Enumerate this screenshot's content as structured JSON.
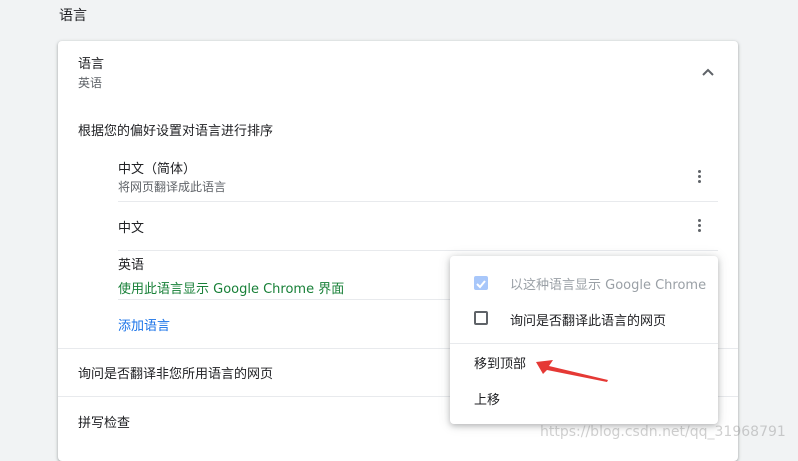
{
  "section_title": "语言",
  "languages_card": {
    "header_title": "语言",
    "header_value": "英语",
    "order_label": "根据您的偏好设置对语言进行排序",
    "items": [
      {
        "name": "中文（简体）",
        "subtitle": "将网页翻译成此语言"
      },
      {
        "name": "中文"
      },
      {
        "name": "英语",
        "subtitle": "使用此语言显示 Google Chrome 界面"
      }
    ],
    "add_language": "添加语言",
    "translate_option": "询问是否翻译非您所用语言的网页",
    "spellcheck": "拼写检查"
  },
  "context_menu": {
    "display_option": "以这种语言显示 Google Chrome",
    "translate_option": "询问是否翻译此语言的网页",
    "move_to_top": "移到顶部",
    "move_up": "上移",
    "display_checked": true,
    "translate_checked": false
  },
  "watermark": "https://blog.csdn.net/qq_31968791",
  "colors": {
    "accent": "#1a73e8",
    "green": "#188038",
    "arrow": "#e53935"
  },
  "icons": {
    "collapse": "chevron-up-icon",
    "more": "more-vert-icon",
    "check": "check-icon",
    "annotation": "red-arrow-icon"
  }
}
